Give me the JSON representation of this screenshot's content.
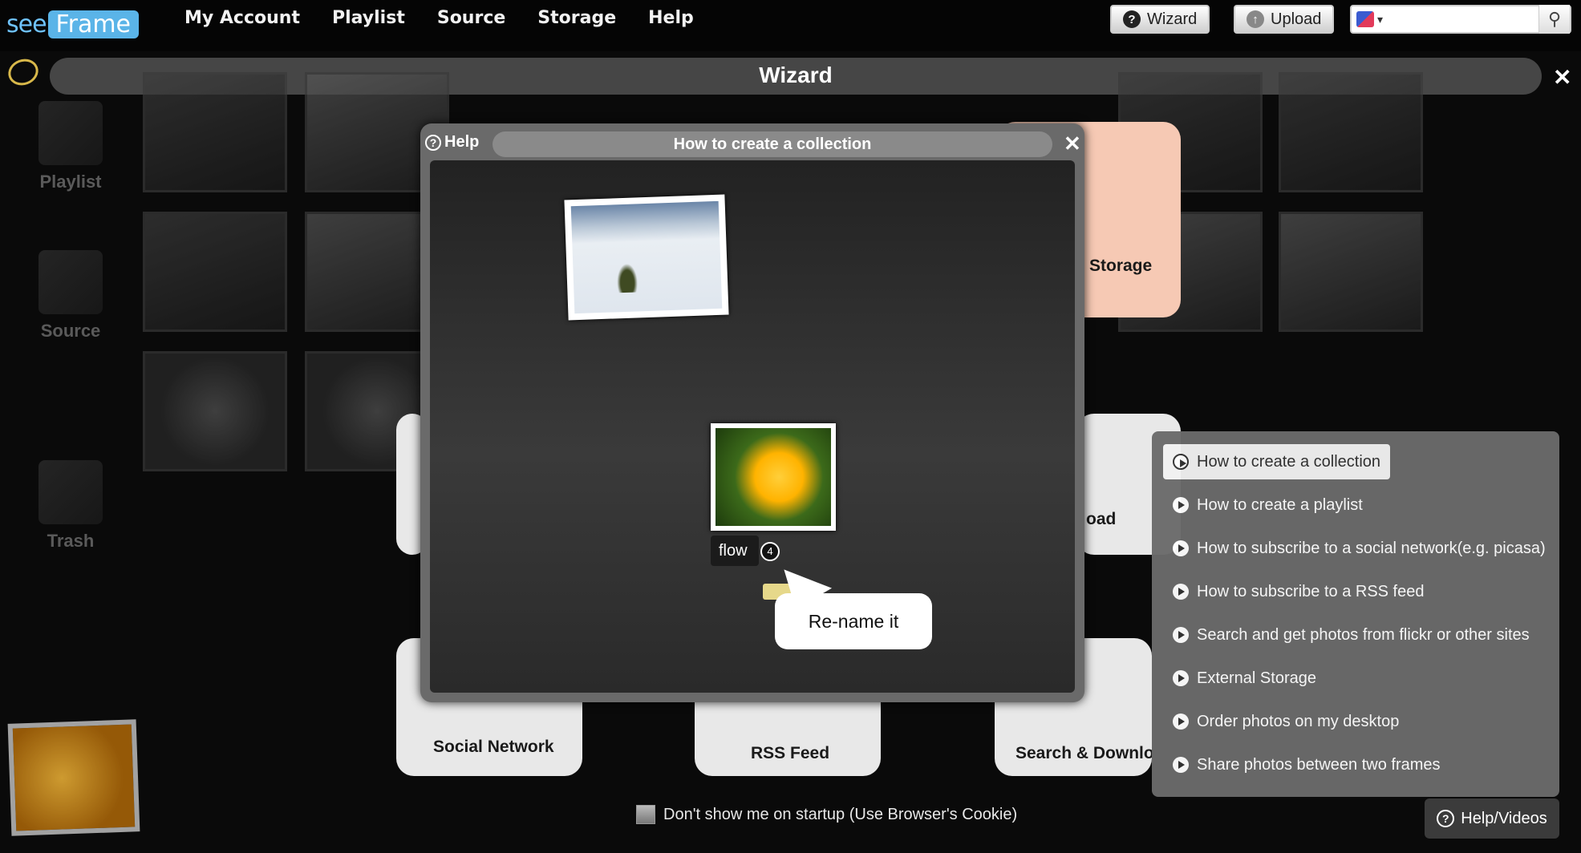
{
  "app": {
    "logo_see": "see",
    "logo_frame": "Frame"
  },
  "nav": [
    "My Account",
    "Playlist",
    "Source",
    "Storage",
    "Help"
  ],
  "toolbar": {
    "wizard_label": "Wizard",
    "upload_label": "Upload",
    "search_value": ""
  },
  "wizard": {
    "title": "Wizard"
  },
  "sidebar": [
    {
      "label": "Playlist",
      "icon": "playlist-icon"
    },
    {
      "label": "Source",
      "icon": "source-icon"
    },
    {
      "label": "Trash",
      "icon": "trash-icon"
    }
  ],
  "cards": {
    "storage": "Storage",
    "upload": "oad",
    "social": "Social Network",
    "rss": "RSS Feed",
    "search": "Search & Download"
  },
  "dialog": {
    "help_label": "Help",
    "title": "How to create a collection",
    "rename_value": "flow",
    "count_badge": "4",
    "bubble": "Re-name it"
  },
  "help_list": [
    {
      "label": "How to create a collection",
      "active": true
    },
    {
      "label": "How to create a playlist",
      "active": false
    },
    {
      "label": "How to subscribe to a social network(e.g. picasa)",
      "active": false
    },
    {
      "label": "How to subscribe to a RSS feed",
      "active": false
    },
    {
      "label": "Search and get photos from flickr or other sites",
      "active": false
    },
    {
      "label": "External Storage",
      "active": false
    },
    {
      "label": "Order photos on my desktop",
      "active": false
    },
    {
      "label": "Share photos between two frames",
      "active": false
    }
  ],
  "footer": {
    "checkbox_label": "Don't show me on startup (Use Browser's Cookie)",
    "help_videos": "Help/Videos"
  }
}
